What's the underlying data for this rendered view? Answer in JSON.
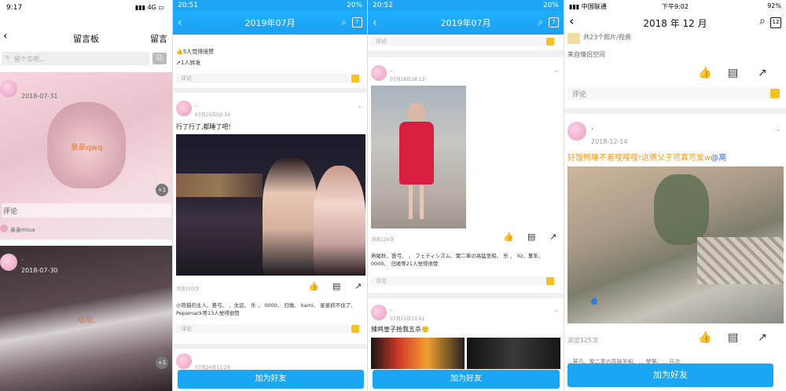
{
  "p1": {
    "time": "9:17",
    "signal": "4G",
    "title": "留言板",
    "right_btn": "留言",
    "input_placeholder": "留个言吧...",
    "msg1": {
      "date": "2018-07-31",
      "text": "亲亲qwq",
      "comment": "评论",
      "author": "亲亲miua",
      "badge": "+1"
    },
    "msg2": {
      "date": "2018-07-30",
      "name": "·",
      "text": "萌萌.",
      "badge": "+1"
    }
  },
  "p2": {
    "time": "20:51",
    "battery": "20%",
    "title": "2019年07月",
    "likes_top": "5人觉得很赞",
    "shares": "1人转发",
    "comment": "评论",
    "post_name": "·",
    "post_time": "07月25日02:34",
    "post_text": "行了行了,都睡了吧!",
    "views": "浏览103次",
    "likers": "小熊猫的主人、荟弓、 、太远、 乐 、 0000、 归墟、 kami、 星星抓不住了、Pepamack等13人觉得很赞",
    "comment2": "评论",
    "next_time": "07月24日11:29",
    "add_btn": "加为好友"
  },
  "p3": {
    "time": "20:52",
    "battery": "20%",
    "title": "2019年07月",
    "comment_top": "评论",
    "post_name": "·",
    "post_time": "07月18日18:13",
    "views": "浏览120次",
    "likers": "燕尾秋、荟弓、 、 フェティシズム、聚二苯の高猛圣船、 乐 、 Xz、堇年、 0000、 归墟等21人觉得很赞",
    "comment2": "评论",
    "post2_name": "·",
    "post2_time": "07月15日13:41",
    "post2_text": "辣鸡皇子抢我五杀🙂",
    "add_btn": "加为好友"
  },
  "p4": {
    "carrier": "中国联通",
    "time": "下午9:02",
    "battery": "92%",
    "title": "2018 年 12 月",
    "top_text": "共23个照片/视频",
    "source": "来自情侣空间",
    "comment": "评论",
    "post_name": "·",
    "post_date": "2018-12-14",
    "post_text": "好饿鸭睡不着嘤嘤嘤!这俩父子可真可爱w",
    "post_mention": "@离",
    "views": "浏览125次",
    "bottom_text": "...荟弓、聚二苯の高猛圣船、... 梦笋、... 乐次",
    "add_btn": "加为好友"
  }
}
